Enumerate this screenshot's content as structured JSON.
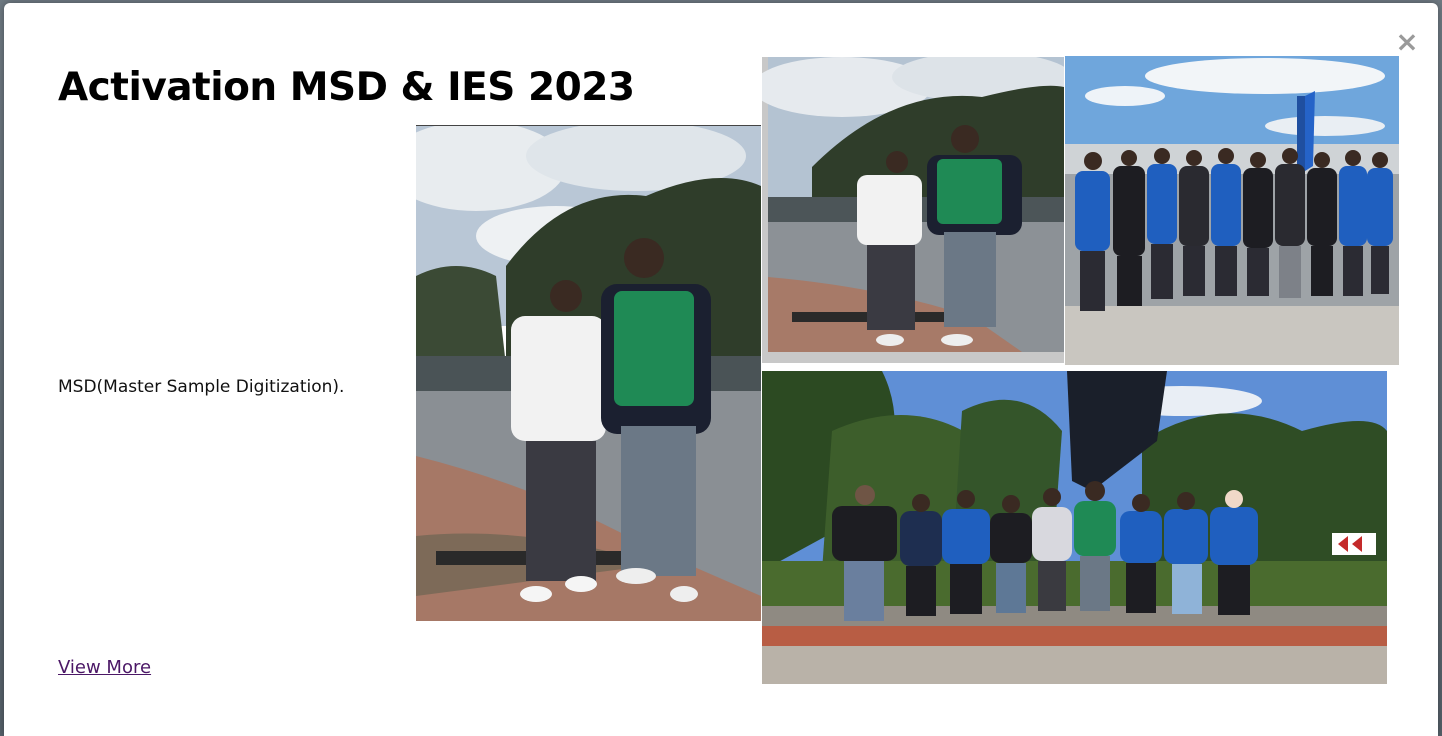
{
  "modal": {
    "close_icon": "×",
    "title": "Activation MSD & IES 2023",
    "description": "MSD(Master Sample Digitization).",
    "view_more_label": "View More"
  },
  "gallery": {
    "photos": [
      {
        "name": "two-people-outdoors-photo"
      },
      {
        "name": "two-people-small-photo"
      },
      {
        "name": "group-blue-jackets-photo"
      },
      {
        "name": "group-palm-trees-photo"
      }
    ]
  },
  "colors": {
    "link": "#4b1766",
    "close": "#9a9a9a",
    "blue_jacket": "#1f5fbf",
    "green_vest": "#1f8a55"
  }
}
